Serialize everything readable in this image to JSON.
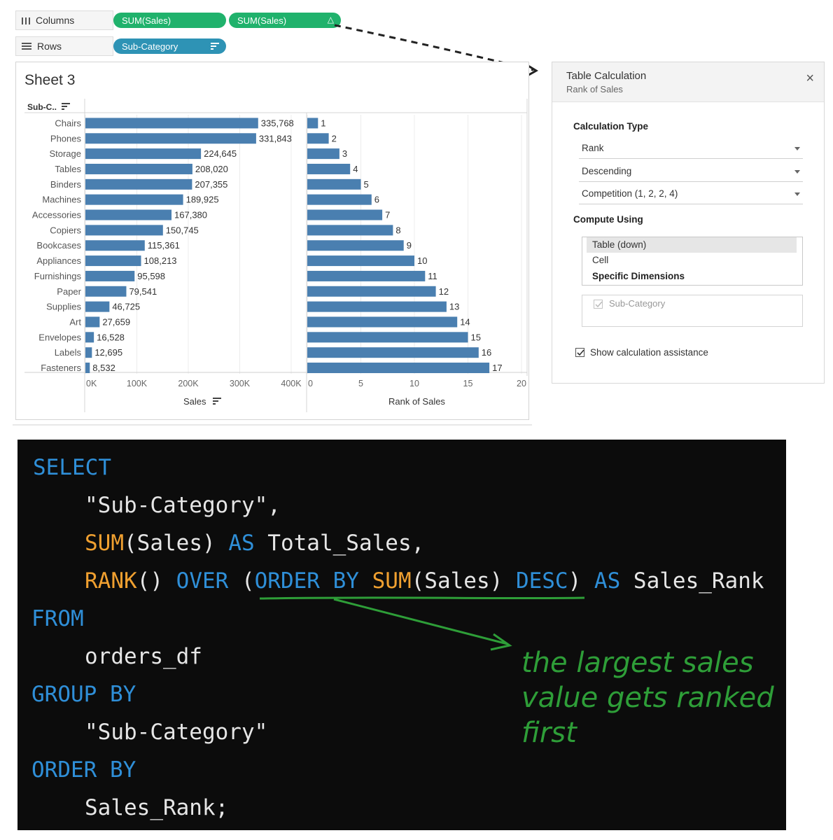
{
  "shelves": {
    "columns_label": "Columns",
    "rows_label": "Rows",
    "columns_pills": [
      "SUM(Sales)",
      "SUM(Sales)"
    ],
    "rows_pill": "Sub-Category"
  },
  "sheet": {
    "title": "Sheet 3",
    "row_header": "Sub-C..",
    "sales_axis_title": "Sales",
    "rank_axis_title": "Rank of Sales",
    "sales_ticks": [
      "0K",
      "100K",
      "200K",
      "300K",
      "400K"
    ],
    "rank_ticks": [
      "0",
      "5",
      "10",
      "15",
      "20"
    ]
  },
  "chart_data": {
    "type": "bar",
    "categories": [
      "Chairs",
      "Phones",
      "Storage",
      "Tables",
      "Binders",
      "Machines",
      "Accessories",
      "Copiers",
      "Bookcases",
      "Appliances",
      "Furnishings",
      "Paper",
      "Supplies",
      "Art",
      "Envelopes",
      "Labels",
      "Fasteners"
    ],
    "series": [
      {
        "name": "SUM(Sales)",
        "values": [
          335768,
          331843,
          224645,
          208020,
          207355,
          189925,
          167380,
          150745,
          115361,
          108213,
          95598,
          79541,
          46725,
          27659,
          16528,
          12695,
          8532
        ],
        "labels": [
          "335,768",
          "331,843",
          "224,645",
          "208,020",
          "207,355",
          "189,925",
          "167,380",
          "150,745",
          "115,361",
          "108,213",
          "95,598",
          "79,541",
          "46,725",
          "27,659",
          "16,528",
          "12,695",
          "8,532"
        ]
      },
      {
        "name": "Rank of Sales",
        "values": [
          1,
          2,
          3,
          4,
          5,
          6,
          7,
          8,
          9,
          10,
          11,
          12,
          13,
          14,
          15,
          16,
          17
        ],
        "labels": [
          "1",
          "2",
          "3",
          "4",
          "5",
          "6",
          "7",
          "8",
          "9",
          "10",
          "11",
          "12",
          "13",
          "14",
          "15",
          "16",
          "17"
        ]
      }
    ],
    "xlim_sales": [
      0,
      400000
    ],
    "xlim_rank": [
      0,
      20
    ],
    "bar_color": "#4a7fb0"
  },
  "panel": {
    "title": "Table Calculation",
    "subtitle": "Rank of Sales",
    "calc_type_heading": "Calculation Type",
    "calc_type": "Rank",
    "order": "Descending",
    "rank_method": "Competition (1, 2, 2, 4)",
    "compute_heading": "Compute Using",
    "compute_options": [
      "Table (down)",
      "Cell",
      "Specific Dimensions"
    ],
    "dimension": "Sub-Category",
    "assist_label": "Show calculation assistance"
  },
  "code": {
    "select": "SELECT",
    "col1": "\"Sub-Category\",",
    "sum": "SUM",
    "sum_rest": "(Sales) ",
    "as": "AS",
    "total_alias": " Total_Sales,",
    "rank": "RANK",
    "parens": "() ",
    "over": "OVER",
    "open_paren": " (",
    "order_by": "ORDER BY",
    "sum2": "SUM",
    "sales2": "(Sales) ",
    "desc": "DESC",
    "close_paren": ") ",
    "as2": "AS",
    "rank_alias": " Sales_Rank",
    "from": "FROM",
    "table": "orders_df",
    "group_by": "GROUP BY",
    "group_col": "\"Sub-Category\"",
    "order_by2": "ORDER BY",
    "order_col": "Sales_Rank;"
  },
  "annotation": [
    "the largest sales",
    "value gets ranked",
    "first"
  ]
}
